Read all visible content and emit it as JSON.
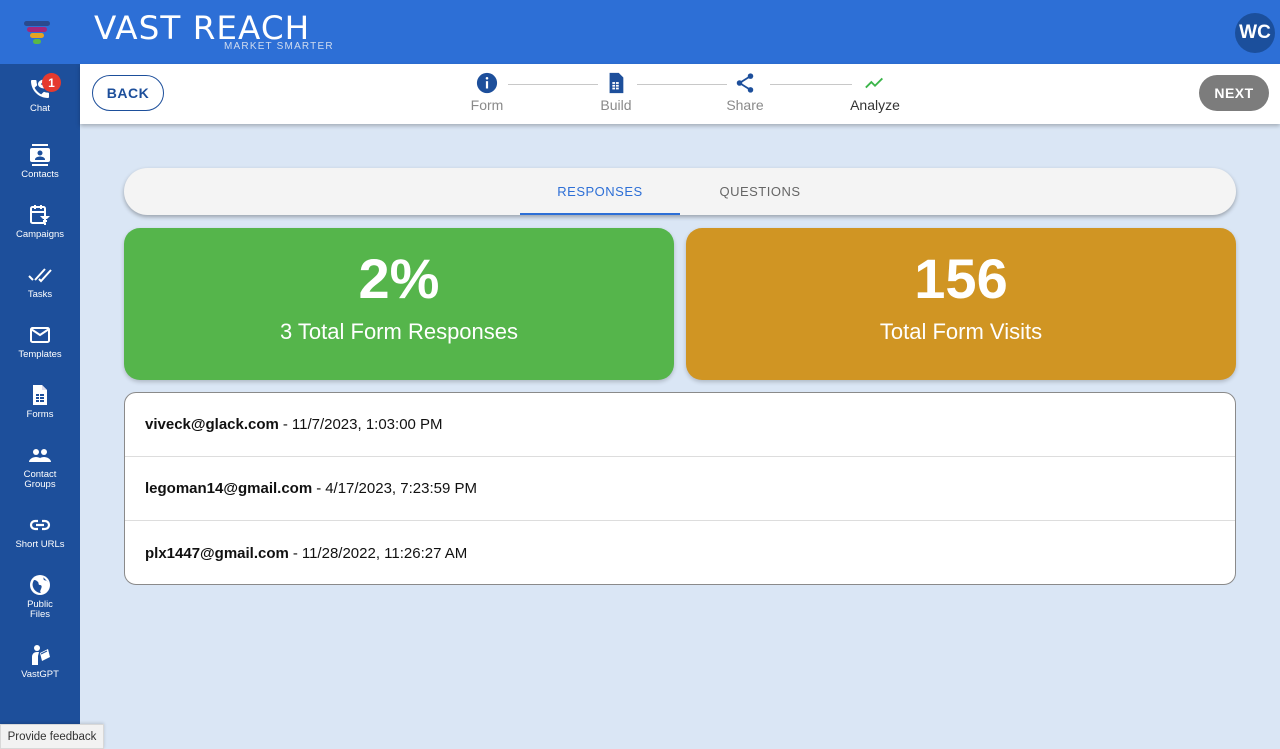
{
  "app": {
    "brand_name": "VAST REACH",
    "brand_tagline": "MARKET SMARTER",
    "user_initials": "WC",
    "colors": {
      "header_blue": "#2d6fd6",
      "sidebar_blue": "#1d4f9b",
      "background": "#dae6f5",
      "responses_card": "#55b54b",
      "visits_card": "#d09523",
      "badge_red": "#e53a2e",
      "analyze_green": "#3bb54a"
    }
  },
  "sidebar": {
    "items": [
      {
        "label": "Chat",
        "icon": "chat-phone-icon",
        "badge": "1"
      },
      {
        "label": "Contacts",
        "icon": "contacts-icon"
      },
      {
        "label": "Campaigns",
        "icon": "campaigns-icon"
      },
      {
        "label": "Tasks",
        "icon": "tasks-icon"
      },
      {
        "label": "Templates",
        "icon": "mail-icon"
      },
      {
        "label": "Forms",
        "icon": "form-icon"
      },
      {
        "label": "Contact\nGroups",
        "icon": "groups-icon"
      },
      {
        "label": "Short URLs",
        "icon": "link-icon"
      },
      {
        "label": "Public\nFiles",
        "icon": "globe-icon"
      },
      {
        "label": "VastGPT",
        "icon": "assistant-icon"
      }
    ],
    "feedback_label": "Provide feedback"
  },
  "stepper": {
    "back_label": "BACK",
    "next_label": "NEXT",
    "steps": [
      {
        "label": "Form",
        "icon": "info-icon"
      },
      {
        "label": "Build",
        "icon": "document-icon"
      },
      {
        "label": "Share",
        "icon": "share-icon"
      },
      {
        "label": "Analyze",
        "icon": "trending-icon",
        "active": true
      }
    ]
  },
  "tabs": [
    {
      "label": "RESPONSES",
      "active": true
    },
    {
      "label": "QUESTIONS",
      "active": false
    }
  ],
  "stats": {
    "response_rate": "2%",
    "responses_label": "3 Total Form Responses",
    "visits": "156",
    "visits_label": "Total Form Visits"
  },
  "responses": [
    {
      "email": "viveck@glack.com",
      "timestamp": "11/7/2023, 1:03:00 PM"
    },
    {
      "email": "legoman14@gmail.com",
      "timestamp": "4/17/2023, 7:23:59 PM"
    },
    {
      "email": "plx1447@gmail.com",
      "timestamp": "11/28/2022, 11:26:27 AM"
    }
  ]
}
